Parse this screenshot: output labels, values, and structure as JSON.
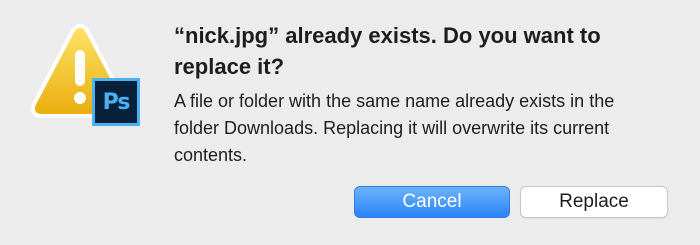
{
  "dialog": {
    "title": "“nick.jpg” already exists. Do you want to replace it?",
    "message": "A file or folder with the same name already exists in the folder Downloads. Replacing it will overwrite its current contents.",
    "icons": {
      "warning": "warning-triangle-icon",
      "app": "photoshop-app-icon",
      "app_label": "Ps"
    },
    "buttons": {
      "cancel_label": "Cancel",
      "replace_label": "Replace"
    }
  },
  "colors": {
    "background": "#ececec",
    "primary_button": "#2a84f6",
    "warning_yellow": "#f4c419",
    "photoshop_blue": "#4ab2f2"
  }
}
